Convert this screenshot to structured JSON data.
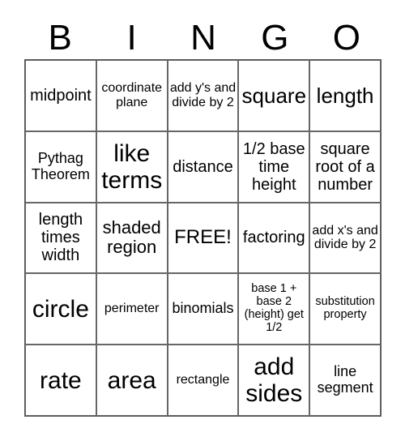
{
  "header": [
    "B",
    "I",
    "N",
    "G",
    "O"
  ],
  "cells": [
    [
      "midpoint",
      "coordinate plane",
      "add y's and divide by 2",
      "square",
      "length"
    ],
    [
      "Pythag Theorem",
      "like terms",
      "distance",
      "1/2 base time height",
      "square root of a number"
    ],
    [
      "length times width",
      "shaded region",
      "FREE!",
      "factoring",
      "add x's and divide by 2"
    ],
    [
      "circle",
      "perimeter",
      "binomials",
      "base 1 + base 2 (height) get 1/2",
      "substitution property"
    ],
    [
      "rate",
      "area",
      "rectangle",
      "add sides",
      "line segment"
    ]
  ]
}
